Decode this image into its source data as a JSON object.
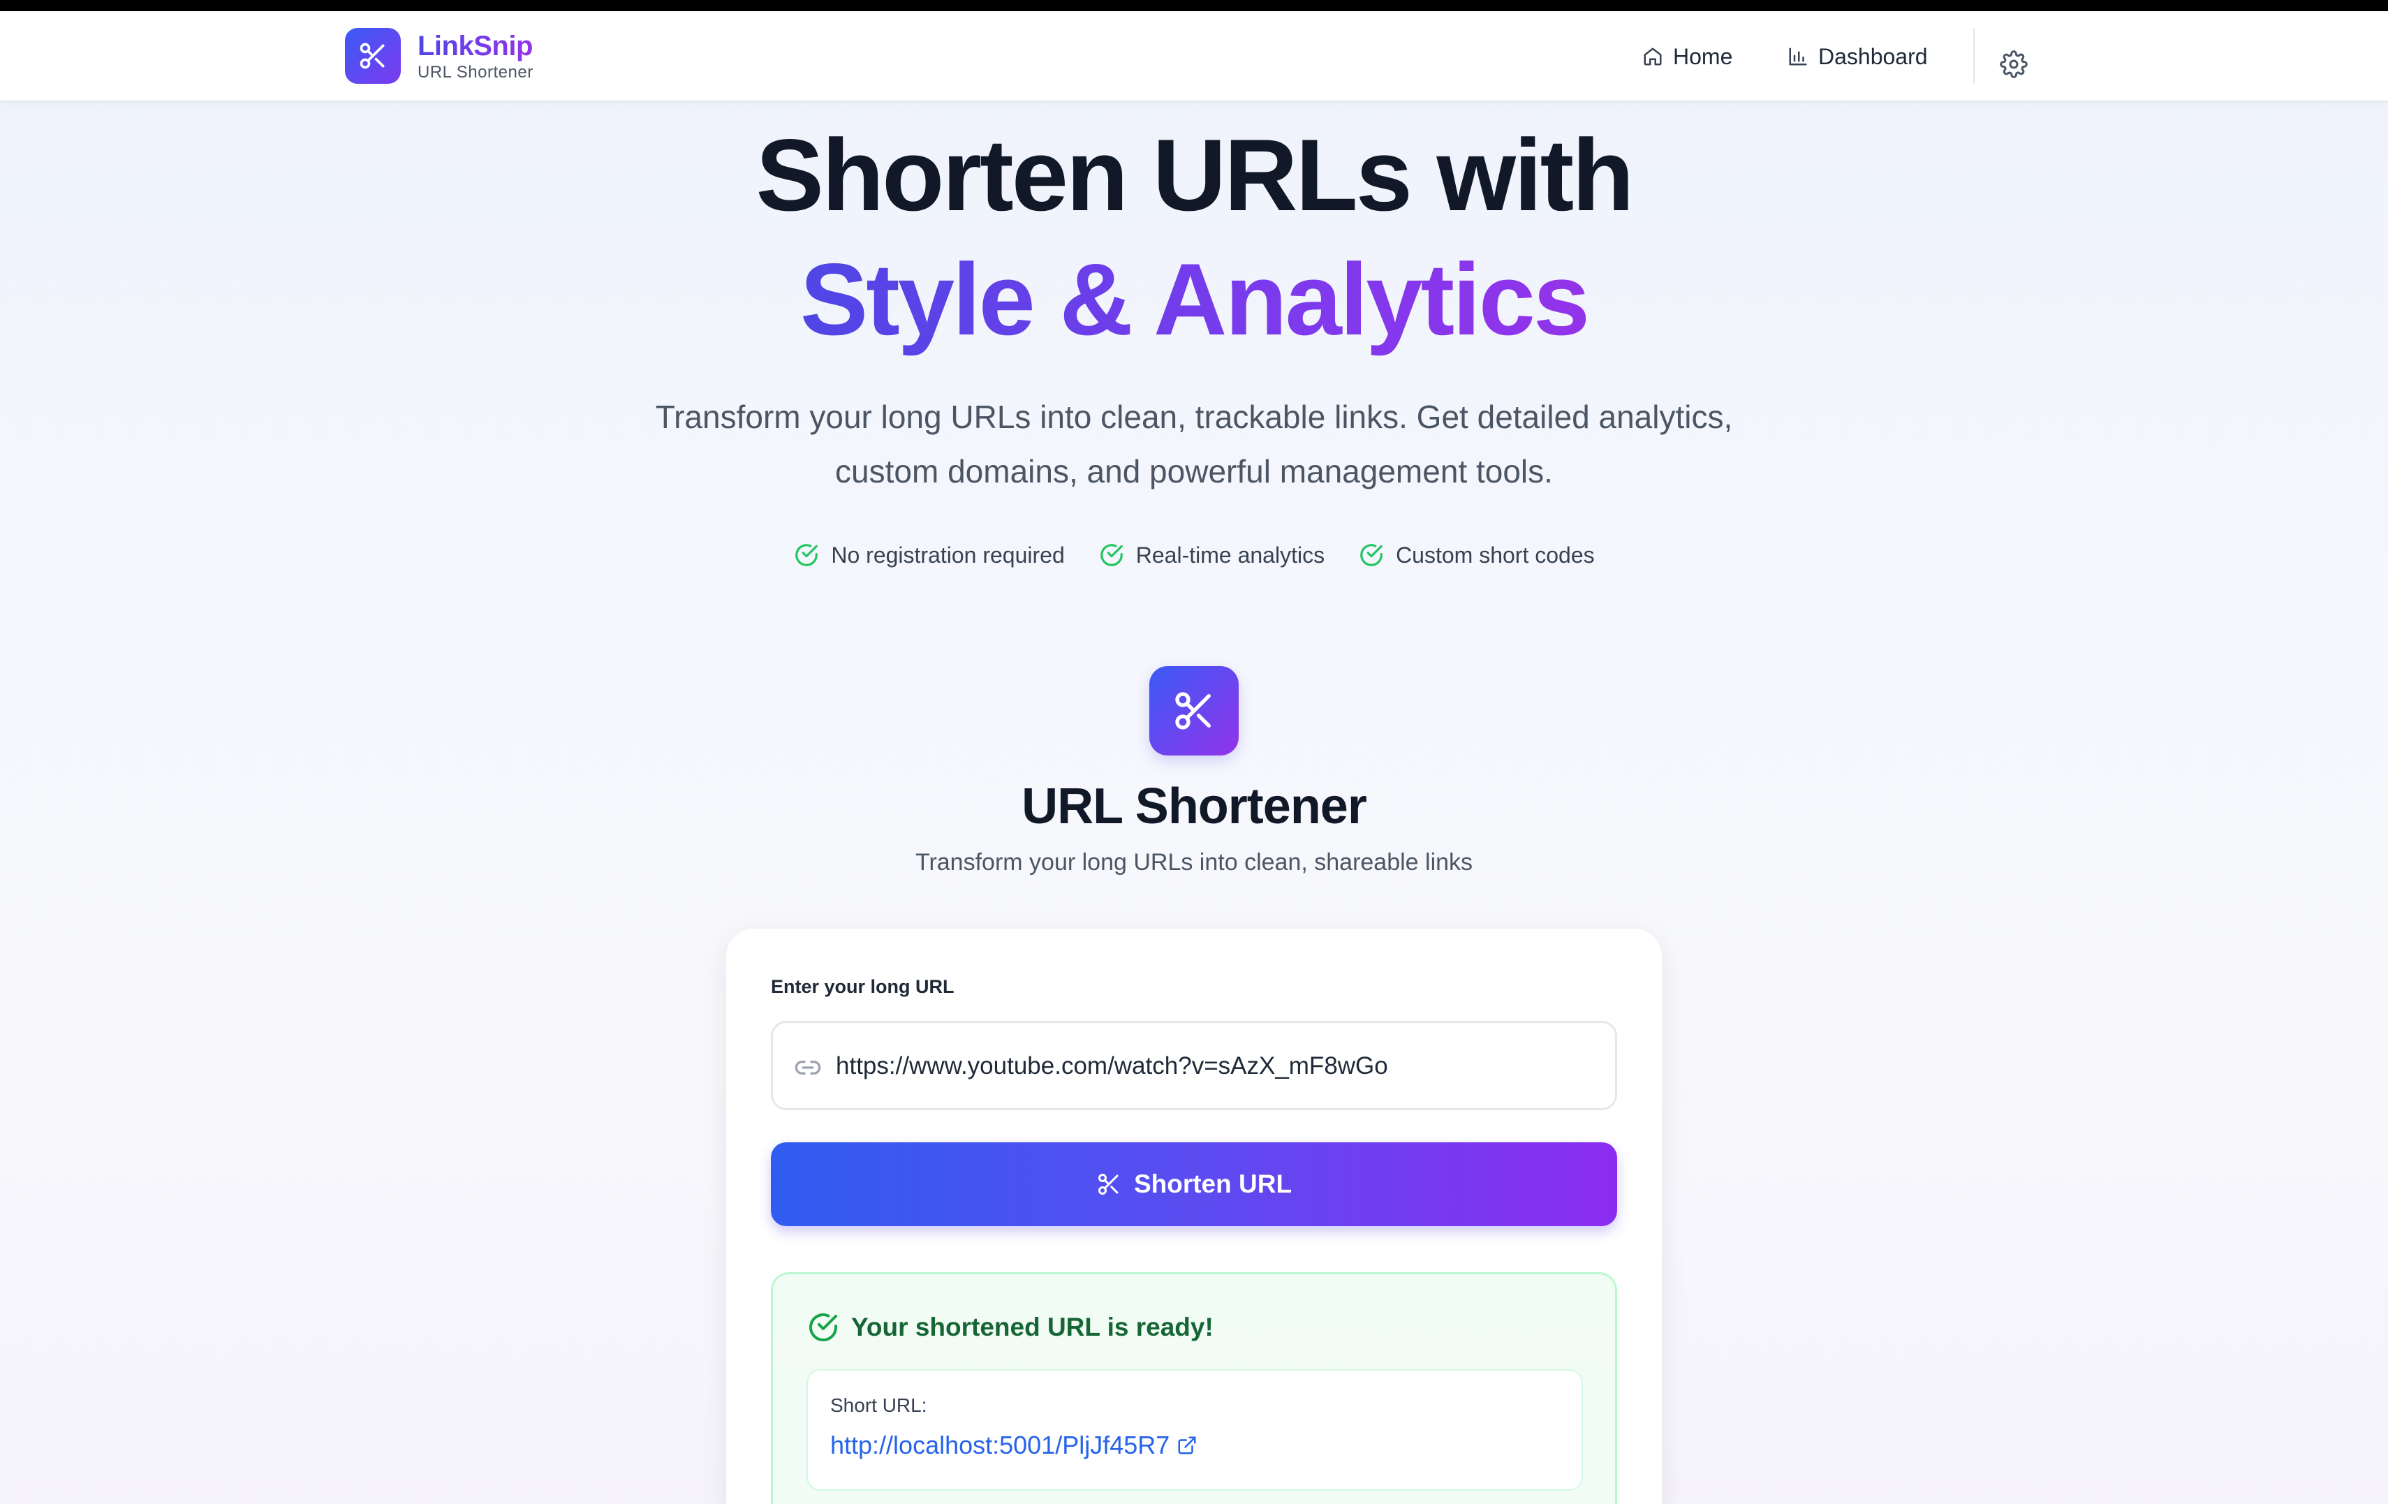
{
  "brand": {
    "name": "LinkSnip",
    "subtitle": "URL Shortener"
  },
  "nav": {
    "home": "Home",
    "dashboard": "Dashboard"
  },
  "hero": {
    "title_line1": "Shorten URLs with",
    "title_line2": "Style & Analytics",
    "desc_line1": "Transform your long URLs into clean, trackable links. Get detailed analytics,",
    "desc_line2": "custom domains, and powerful management tools."
  },
  "features": [
    "No registration required",
    "Real-time analytics",
    "Custom short codes"
  ],
  "shortener": {
    "title": "URL Shortener",
    "subtitle": "Transform your long URLs into clean, shareable links",
    "input_label": "Enter your long URL",
    "input_value": "https://www.youtube.com/watch?v=sAzX_mF8wGo",
    "button_label": "Shorten URL"
  },
  "result": {
    "heading": "Your shortened URL is ready!",
    "short_label": "Short URL:",
    "short_url": "http://localhost:5001/PljJf45R7"
  },
  "colors": {
    "accent_start": "#3b5bf6",
    "accent_end": "#9333ea",
    "success": "#22c55e",
    "link": "#2563eb"
  }
}
